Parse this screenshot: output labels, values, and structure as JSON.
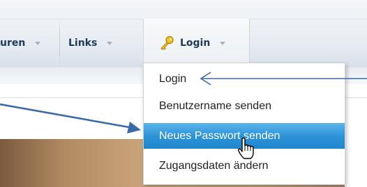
{
  "nav": {
    "partial_label": "uren",
    "links_label": "Links",
    "login_label": "Login",
    "login_icon": "key-icon",
    "caret_icon": "chevron-down-icon"
  },
  "dropdown": {
    "items": [
      {
        "label": "Login",
        "state": "normal"
      },
      {
        "label": "Benutzername senden",
        "state": "normal"
      },
      {
        "label": "Neues Passwort senden",
        "state": "highlighted"
      },
      {
        "label": "Zugangsdaten ändern",
        "state": "normal"
      }
    ]
  },
  "annotations": {
    "arrow_color": "#3a6aa8",
    "highlight_color": "#2e94d8",
    "cursor": "hand-pointer-cursor"
  }
}
